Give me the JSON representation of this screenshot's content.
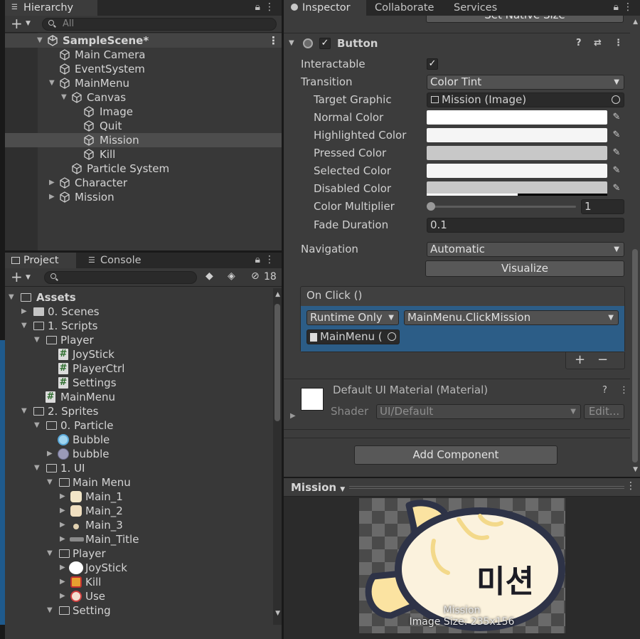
{
  "hierarchy": {
    "tab_label": "Hierarchy",
    "search_placeholder": "All",
    "scene_name": "SampleScene*",
    "items": [
      {
        "label": "Main Camera"
      },
      {
        "label": "EventSystem"
      },
      {
        "label": "MainMenu"
      },
      {
        "label": "Canvas"
      },
      {
        "label": "Image"
      },
      {
        "label": "Quit"
      },
      {
        "label": "Mission"
      },
      {
        "label": "Kill"
      },
      {
        "label": "Particle System"
      },
      {
        "label": "Character"
      },
      {
        "label": "Mission"
      }
    ]
  },
  "project": {
    "tabs": [
      {
        "label": "Project"
      },
      {
        "label": "Console"
      }
    ],
    "hidden_count": "18",
    "items": [
      {
        "label": "Assets"
      },
      {
        "label": "0. Scenes"
      },
      {
        "label": "1. Scripts"
      },
      {
        "label": "Player"
      },
      {
        "label": "JoyStick"
      },
      {
        "label": "PlayerCtrl"
      },
      {
        "label": "Settings"
      },
      {
        "label": "MainMenu"
      },
      {
        "label": "2. Sprites"
      },
      {
        "label": "0. Particle"
      },
      {
        "label": "Bubble"
      },
      {
        "label": "bubble"
      },
      {
        "label": "1. UI"
      },
      {
        "label": "Main Menu"
      },
      {
        "label": "Main_1"
      },
      {
        "label": "Main_2"
      },
      {
        "label": "Main_3"
      },
      {
        "label": "Main_Title"
      },
      {
        "label": "Player"
      },
      {
        "label": "JoyStick"
      },
      {
        "label": "Kill"
      },
      {
        "label": "Use"
      },
      {
        "label": "Setting"
      }
    ]
  },
  "inspector": {
    "tabs": [
      {
        "label": "Inspector"
      },
      {
        "label": "Collaborate"
      },
      {
        "label": "Services"
      }
    ],
    "partial_button_label": "Set Native Size",
    "component_title": "Button",
    "interactable_label": "Interactable",
    "transition_label": "Transition",
    "transition_value": "Color Tint",
    "target_graphic_label": "Target Graphic",
    "target_graphic_value": "Mission (Image)",
    "normal_color_label": "Normal Color",
    "highlighted_color_label": "Highlighted Color",
    "pressed_color_label": "Pressed Color",
    "selected_color_label": "Selected Color",
    "disabled_color_label": "Disabled Color",
    "color_multiplier_label": "Color Multiplier",
    "color_multiplier_value": "1",
    "fade_duration_label": "Fade Duration",
    "fade_duration_value": "0.1",
    "navigation_label": "Navigation",
    "navigation_value": "Automatic",
    "visualize_label": "Visualize",
    "onclick_label": "On Click ()",
    "runtime_value": "Runtime Only",
    "function_value": "MainMenu.ClickMission",
    "object_value": "MainMenu (",
    "add_listener": "+",
    "remove_listener": "−",
    "material_title": "Default UI Material (Material)",
    "shader_label": "Shader",
    "shader_value": "UI/Default",
    "edit_label": "Edit...",
    "add_component_label": "Add Component",
    "colors": {
      "normal": "#ffffff",
      "highlighted": "#f5f5f5",
      "pressed": "#c8c8c8",
      "selected": "#f5f5f5",
      "disabled": "#c8c8c8"
    }
  },
  "preview": {
    "dropdown_label": "Mission",
    "caption": "Mission",
    "image_size": "Image Size: 235x156",
    "sprite_text": "미션"
  }
}
